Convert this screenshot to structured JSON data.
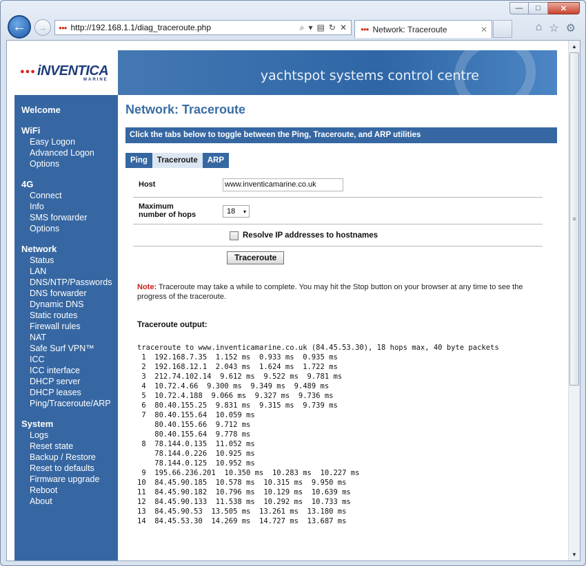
{
  "browser": {
    "url": "http://192.168.1.1/diag_traceroute.php",
    "tab_title": "Network: Traceroute",
    "window_controls": {
      "minimize": "—",
      "maximize": "□",
      "close": "✕"
    },
    "nav": {
      "back": "←",
      "forward": "→"
    },
    "address_tools": {
      "search": "⌕",
      "dropdown": "▾",
      "compat": "▤",
      "refresh": "↻",
      "stop": "✕"
    },
    "tab_close": "✕",
    "toolbar_icons": {
      "home": "⌂",
      "favorites": "☆",
      "settings": "⚙"
    },
    "scroll": {
      "up": "▲",
      "down": "▼",
      "grip": "≡"
    }
  },
  "logo": {
    "dots": "●●●",
    "name": "iNVENTICA",
    "sub": "MARINE"
  },
  "banner": {
    "text": "yachtspot systems control centre"
  },
  "sidebar": {
    "welcome": "Welcome",
    "wifi": {
      "title": "WiFi",
      "items": [
        "Easy Logon",
        "Advanced Logon",
        "Options"
      ]
    },
    "g4": {
      "title": "4G",
      "items": [
        "Connect",
        "Info",
        "SMS forwarder",
        "Options"
      ]
    },
    "network": {
      "title": "Network",
      "items": [
        "Status",
        "LAN",
        "DNS/NTP/Passwords",
        "DNS forwarder",
        "Dynamic DNS",
        "Static routes",
        "Firewall rules",
        "NAT",
        "Safe Surf VPN™",
        "ICC",
        "ICC interface",
        "DHCP server",
        "DHCP leases",
        "Ping/Traceroute/ARP"
      ]
    },
    "system": {
      "title": "System",
      "items": [
        "Logs",
        "Reset state",
        "Backup / Restore",
        "Reset to defaults",
        "Firmware upgrade",
        "Reboot",
        "About"
      ]
    }
  },
  "main": {
    "title": "Network: Traceroute",
    "info": "Click the tabs below to toggle between the Ping, Traceroute, and ARP utilities",
    "tabs": [
      "Ping",
      "Traceroute",
      "ARP"
    ],
    "active_tab": "Traceroute",
    "form": {
      "host_label": "Host",
      "host_value": "www.inventicamarine.co.uk",
      "hops_label_1": "Maximum",
      "hops_label_2": "number of hops",
      "hops_value": "18",
      "resolve_label": "Resolve IP addresses to hostnames",
      "submit": "Traceroute"
    },
    "note_label": "Note:",
    "note_text": " Traceroute may take a while to complete. You may hit the Stop button on your browser at any time to see the progress of the traceroute.",
    "output_title": "Traceroute output:",
    "output": "traceroute to www.inventicamarine.co.uk (84.45.53.30), 18 hops max, 40 byte packets\n 1  192.168.7.35  1.152 ms  0.933 ms  0.935 ms\n 2  192.168.12.1  2.043 ms  1.624 ms  1.722 ms\n 3  212.74.102.14  9.612 ms  9.522 ms  9.781 ms\n 4  10.72.4.66  9.300 ms  9.349 ms  9.489 ms\n 5  10.72.4.188  9.066 ms  9.327 ms  9.736 ms\n 6  80.40.155.25  9.831 ms  9.315 ms  9.739 ms\n 7  80.40.155.64  10.059 ms\n    80.40.155.66  9.712 ms\n    80.40.155.64  9.778 ms\n 8  78.144.0.135  11.052 ms\n    78.144.0.226  10.925 ms\n    78.144.0.125  10.952 ms\n 9  195.66.236.201  10.350 ms  10.283 ms  10.227 ms\n10  84.45.90.185  10.578 ms  10.315 ms  9.950 ms\n11  84.45.90.182  10.796 ms  10.129 ms  10.639 ms\n12  84.45.90.133  11.538 ms  10.292 ms  10.733 ms\n13  84.45.90.53  13.505 ms  13.261 ms  13.180 ms\n14  84.45.53.30  14.269 ms  14.727 ms  13.687 ms"
  }
}
